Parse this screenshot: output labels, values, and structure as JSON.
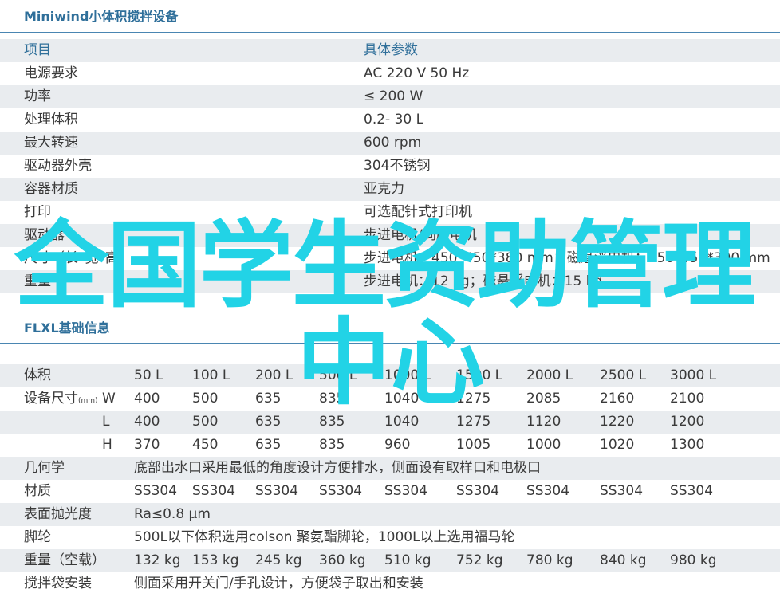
{
  "section1": {
    "title": "Miniwind小体积搅拌设备",
    "header": {
      "item": "项目",
      "param": "具体参数"
    },
    "rows": [
      {
        "label": "电源要求",
        "value": "AC 220 V 50 Hz"
      },
      {
        "label": "功率",
        "value": "≤ 200 W"
      },
      {
        "label": "处理体积",
        "value": "0.2- 30 L"
      },
      {
        "label": "最大转速",
        "value": "600 rpm"
      },
      {
        "label": "驱动器外壳",
        "value": "304不锈钢"
      },
      {
        "label": "容器材质",
        "value": "亚克力"
      },
      {
        "label": "打印",
        "value": "可选配针式打印机"
      },
      {
        "label": "驱动器",
        "value": "步进电机/伺服电机"
      },
      {
        "label": "尺寸（长*宽*高）",
        "value": "步进电机：450*450*380 mm；磁悬浮电机：550*450*390 mm"
      },
      {
        "label": "重量",
        "value": "步进电机：12 kg；磁悬浮电机：15 kg"
      }
    ]
  },
  "section2": {
    "title": "FLXL基础信息",
    "volume_label": "体积",
    "volumes": [
      "50 L",
      "100 L",
      "200 L",
      "500 L",
      "1000 L",
      "1500 L",
      "2000 L",
      "2500 L",
      "3000 L"
    ],
    "size_label": "设备尺寸",
    "size_unit": "(mm)",
    "dims": [
      {
        "axis": "W",
        "values": [
          "400",
          "500",
          "635",
          "835",
          "1040",
          "1275",
          "2085",
          "2160",
          "2100"
        ]
      },
      {
        "axis": "L",
        "values": [
          "400",
          "500",
          "635",
          "835",
          "1040",
          "1275",
          "1120",
          "1220",
          "1200"
        ]
      },
      {
        "axis": "H",
        "values": [
          "370",
          "450",
          "635",
          "835",
          "960",
          "1005",
          "1000",
          "1020",
          "1300"
        ]
      }
    ],
    "geometry": {
      "label": "几何学",
      "value": "底部出水口采用最低的角度设计方便排水，侧面设有取样口和电极口"
    },
    "material": {
      "label": "材质",
      "values": [
        "SS304",
        "SS304",
        "SS304",
        "SS304",
        "SS304",
        "SS304",
        "SS304",
        "SS304",
        "SS304"
      ]
    },
    "polish": {
      "label": "表面抛光度",
      "value": "Ra≤0.8 µm"
    },
    "casters": {
      "label": "脚轮",
      "value": "500L以下体积选用colson 聚氨酯脚轮，1000L以上选用福马轮"
    },
    "weight": {
      "label": "重量（空载）",
      "values": [
        "132 kg",
        "153 kg",
        "245 kg",
        "360 kg",
        "510 kg",
        "752 kg",
        "780 kg",
        "840 kg",
        "980 kg"
      ]
    },
    "bag": {
      "label": "搅拌袋安装",
      "value": "侧面采用开关门/手孔设计，方便袋子取出和安装"
    }
  },
  "overlay": {
    "line1": "全国学生资助管理",
    "line2": "中心"
  },
  "colors": {
    "accent": "#2f6f9a",
    "rule": "#4a86b2",
    "row_shade": "#e9ecef",
    "overlay": "#22d3e6"
  }
}
